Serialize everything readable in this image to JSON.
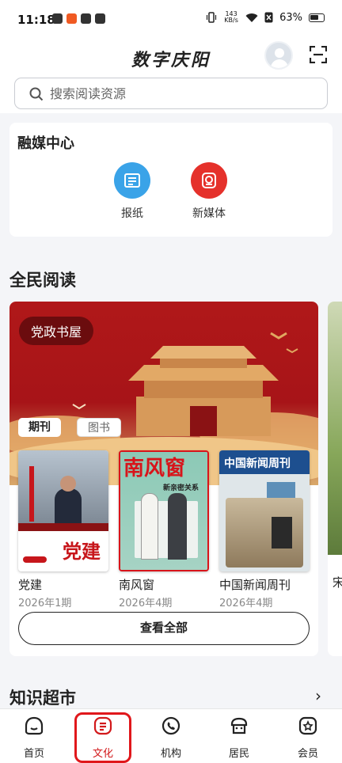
{
  "status_bar": {
    "time": "11:18",
    "speed": "143 KB/s",
    "battery": "63%"
  },
  "header": {
    "app_title": "数字庆阳",
    "search_placeholder": "搜索阅读资源"
  },
  "media_center": {
    "title": "融媒中心",
    "items": [
      {
        "label": "报纸",
        "color": "#3aa3e8",
        "icon": "newspaper-icon"
      },
      {
        "label": "新媒体",
        "color": "#e5312b",
        "icon": "new-media-icon"
      }
    ]
  },
  "reading": {
    "title": "全民阅读",
    "banner_label": "党政书屋",
    "tabs": [
      "期刊",
      "图书"
    ],
    "active_tab": "期刊",
    "books": [
      {
        "title": "党建",
        "issue": "2026年1期",
        "cover_text": "党建"
      },
      {
        "title": "南风窗",
        "issue": "2026年4期",
        "cover_text": "南风窗",
        "cover_sub": "新亲密关系"
      },
      {
        "title": "中国新闻周刊",
        "issue": "2026年4期",
        "cover_text": "中国新闻周刊"
      }
    ],
    "view_all": "查看全部",
    "peek_text": "宋"
  },
  "knowledge": {
    "title": "知识超市"
  },
  "bottom_nav": {
    "items": [
      "首页",
      "文化",
      "机构",
      "居民",
      "会员"
    ],
    "active": "文化"
  }
}
